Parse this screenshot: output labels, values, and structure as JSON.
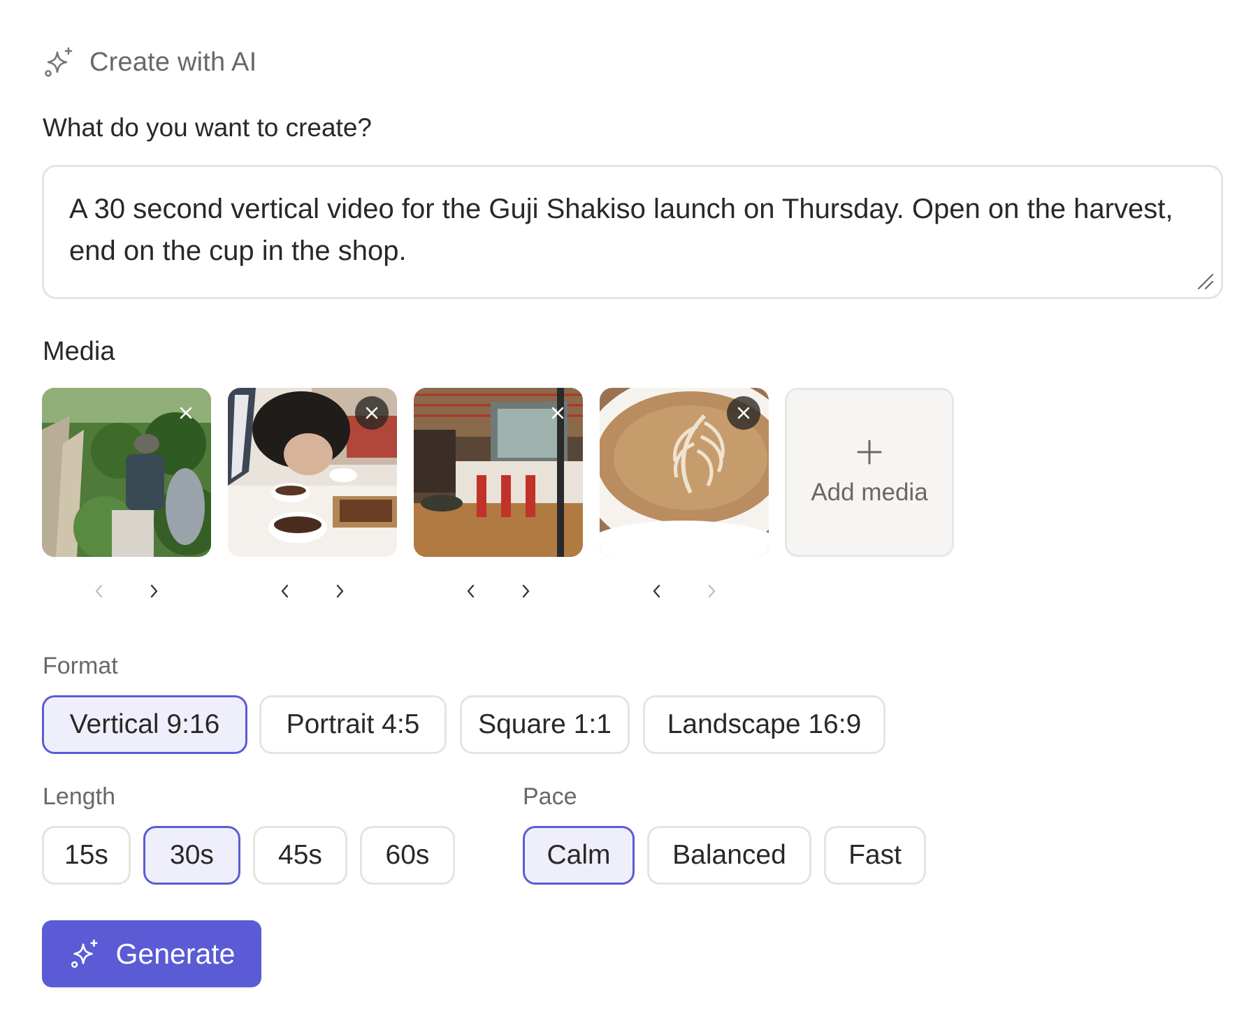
{
  "header": {
    "title": "Create with AI",
    "icon": "sparkle-icon"
  },
  "prompt": {
    "label": "What do you want to create?",
    "value": "A 30 second vertical video for the Guji Shakiso launch on Thursday. Open on the harvest, end on the cup in the shop."
  },
  "media": {
    "label": "Media",
    "items": [
      {
        "name": "coffee harvest",
        "remove_icon": "close-icon"
      },
      {
        "name": "coffee cupping",
        "remove_icon": "close-icon"
      },
      {
        "name": "coffee shop interior",
        "remove_icon": "close-icon"
      },
      {
        "name": "latte art cup",
        "remove_icon": "close-icon"
      }
    ],
    "add_label": "Add media"
  },
  "format": {
    "label": "Format",
    "options": [
      "Vertical 9:16",
      "Portrait 4:5",
      "Square 1:1",
      "Landscape 16:9"
    ],
    "selected": "Vertical 9:16"
  },
  "length": {
    "label": "Length",
    "options": [
      "15s",
      "30s",
      "45s",
      "60s"
    ],
    "selected": "30s"
  },
  "pace": {
    "label": "Pace",
    "options": [
      "Calm",
      "Balanced",
      "Fast"
    ],
    "selected": "Calm"
  },
  "generate": {
    "label": "Generate",
    "icon": "sparkle-icon"
  },
  "colors": {
    "accent": "#5b5bd6",
    "accent_bg": "#efeffb",
    "border": "#e6e4e1"
  }
}
